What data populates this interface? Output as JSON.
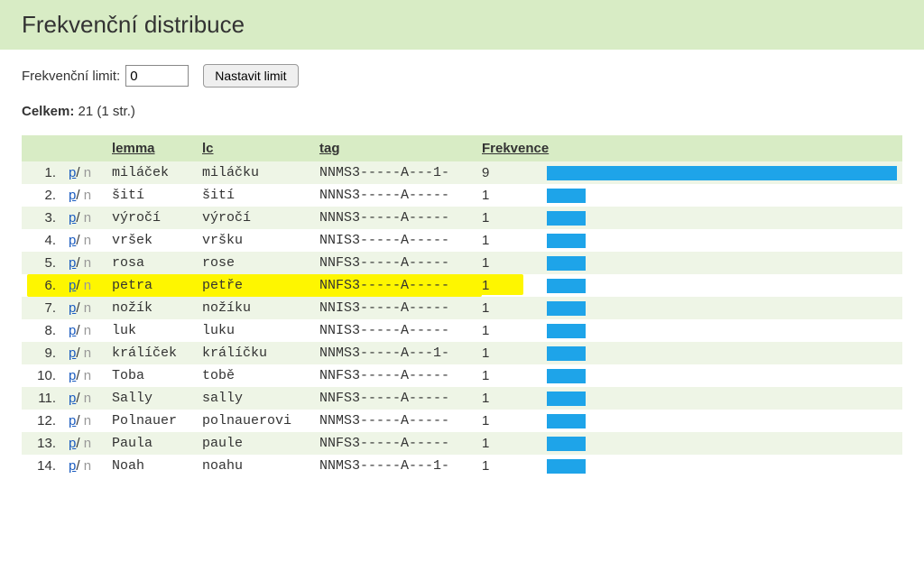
{
  "title": "Frekvenční distribuce",
  "controls": {
    "limit_label": "Frekvenční limit:",
    "limit_value": "0",
    "set_limit_button": "Nastavit limit"
  },
  "summary": {
    "label": "Celkem:",
    "value": "21 (1 str.)"
  },
  "colors": {
    "bar": "#1ea4e9",
    "highlight": "#fef600"
  },
  "headers": {
    "lemma": "lemma",
    "lc": "lc",
    "tag": "tag",
    "freq": "Frekvence"
  },
  "pn_link": {
    "p": "p",
    "n": "n"
  },
  "max_freq": 9,
  "rows": [
    {
      "idx": "1.",
      "lemma": "miláček",
      "lc": "miláčku",
      "tag": "NNMS3-----A---1-",
      "freq": 9,
      "highlight": false
    },
    {
      "idx": "2.",
      "lemma": "šití",
      "lc": "šití",
      "tag": "NNNS3-----A-----",
      "freq": 1,
      "highlight": false
    },
    {
      "idx": "3.",
      "lemma": "výročí",
      "lc": "výročí",
      "tag": "NNNS3-----A-----",
      "freq": 1,
      "highlight": false
    },
    {
      "idx": "4.",
      "lemma": "vršek",
      "lc": "vršku",
      "tag": "NNIS3-----A-----",
      "freq": 1,
      "highlight": false
    },
    {
      "idx": "5.",
      "lemma": "rosa",
      "lc": "rose",
      "tag": "NNFS3-----A-----",
      "freq": 1,
      "highlight": false
    },
    {
      "idx": "6.",
      "lemma": "petra",
      "lc": "petře",
      "tag": "NNFS3-----A-----",
      "freq": 1,
      "highlight": true
    },
    {
      "idx": "7.",
      "lemma": "nožík",
      "lc": "nožíku",
      "tag": "NNIS3-----A-----",
      "freq": 1,
      "highlight": false
    },
    {
      "idx": "8.",
      "lemma": "luk",
      "lc": "luku",
      "tag": "NNIS3-----A-----",
      "freq": 1,
      "highlight": false
    },
    {
      "idx": "9.",
      "lemma": "králíček",
      "lc": "králíčku",
      "tag": "NNMS3-----A---1-",
      "freq": 1,
      "highlight": false
    },
    {
      "idx": "10.",
      "lemma": "Toba",
      "lc": "tobě",
      "tag": "NNFS3-----A-----",
      "freq": 1,
      "highlight": false
    },
    {
      "idx": "11.",
      "lemma": "Sally",
      "lc": "sally",
      "tag": "NNFS3-----A-----",
      "freq": 1,
      "highlight": false
    },
    {
      "idx": "12.",
      "lemma": "Polnauer",
      "lc": "polnauerovi",
      "tag": "NNMS3-----A-----",
      "freq": 1,
      "highlight": false
    },
    {
      "idx": "13.",
      "lemma": "Paula",
      "lc": "paule",
      "tag": "NNFS3-----A-----",
      "freq": 1,
      "highlight": false
    },
    {
      "idx": "14.",
      "lemma": "Noah",
      "lc": "noahu",
      "tag": "NNMS3-----A---1-",
      "freq": 1,
      "highlight": false
    }
  ]
}
